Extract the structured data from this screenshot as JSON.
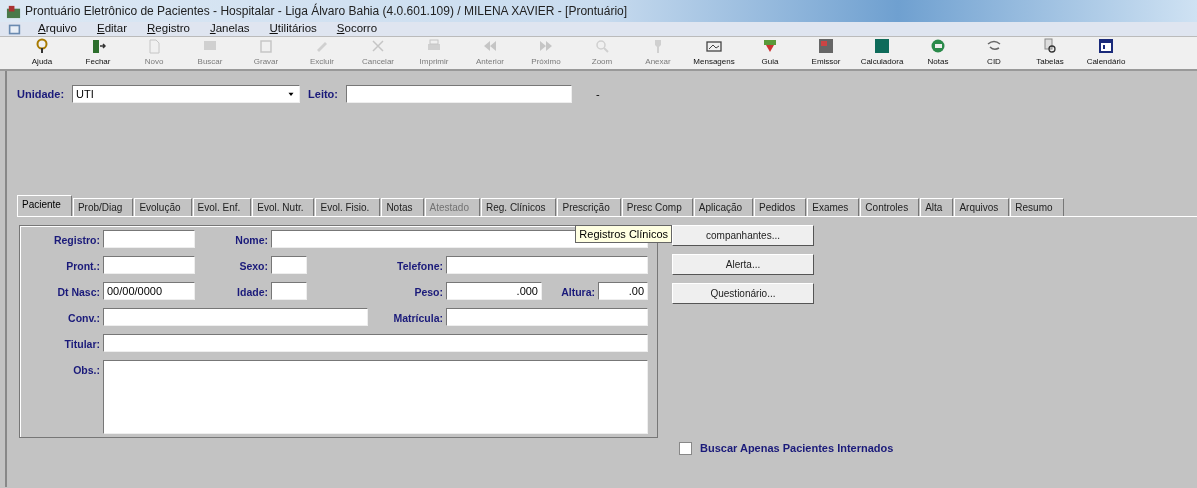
{
  "window": {
    "title": "Prontuário Eletrônico de Pacientes - Hospitalar - Liga Álvaro Bahia (4.0.601.109) / MILENA XAVIER - [Prontuário]"
  },
  "menu": [
    "Arquivo",
    "Editar",
    "Registro",
    "Janelas",
    "Utilitários",
    "Socorro"
  ],
  "toolbar": [
    {
      "label": "Ajuda",
      "disabled": false
    },
    {
      "label": "Fechar",
      "disabled": false
    },
    {
      "label": "Novo",
      "disabled": true
    },
    {
      "label": "Buscar",
      "disabled": true
    },
    {
      "label": "Gravar",
      "disabled": true
    },
    {
      "label": "Excluir",
      "disabled": true
    },
    {
      "label": "Cancelar",
      "disabled": true
    },
    {
      "label": "Imprimir",
      "disabled": true
    },
    {
      "label": "Anterior",
      "disabled": true
    },
    {
      "label": "Próximo",
      "disabled": true
    },
    {
      "label": "Zoom",
      "disabled": true
    },
    {
      "label": "Anexar",
      "disabled": true
    },
    {
      "label": "Mensagens",
      "disabled": false
    },
    {
      "label": "Guia",
      "disabled": false
    },
    {
      "label": "Emissor",
      "disabled": false
    },
    {
      "label": "Calculadora",
      "disabled": false
    },
    {
      "label": "Notas",
      "disabled": false
    },
    {
      "label": "CID",
      "disabled": false
    },
    {
      "label": "Tabelas",
      "disabled": false
    },
    {
      "label": "Calendário",
      "disabled": false
    }
  ],
  "unit": {
    "label": "Unidade:",
    "value": "UTI"
  },
  "bed": {
    "label": "Leito:",
    "suffix": "-"
  },
  "tabs": [
    {
      "label": "Paciente",
      "selected": true,
      "disabled": false
    },
    {
      "label": "Prob/Diag",
      "selected": false,
      "disabled": false
    },
    {
      "label": "Evolução",
      "selected": false,
      "disabled": false
    },
    {
      "label": "Evol. Enf.",
      "selected": false,
      "disabled": false
    },
    {
      "label": "Evol. Nutr.",
      "selected": false,
      "disabled": false
    },
    {
      "label": "Evol. Fisio.",
      "selected": false,
      "disabled": false
    },
    {
      "label": "Notas",
      "selected": false,
      "disabled": false
    },
    {
      "label": "Atestado",
      "selected": false,
      "disabled": true
    },
    {
      "label": "Reg. Clínicos",
      "selected": false,
      "disabled": false
    },
    {
      "label": "Prescrição",
      "selected": false,
      "disabled": false
    },
    {
      "label": "Presc Comp",
      "selected": false,
      "disabled": false
    },
    {
      "label": "Aplicação",
      "selected": false,
      "disabled": false
    },
    {
      "label": "Pedidos",
      "selected": false,
      "disabled": false
    },
    {
      "label": "Exames",
      "selected": false,
      "disabled": false
    },
    {
      "label": "Controles",
      "selected": false,
      "disabled": false
    },
    {
      "label": "Alta",
      "selected": false,
      "disabled": false
    },
    {
      "label": "Arquivos",
      "selected": false,
      "disabled": false
    },
    {
      "label": "Resumo",
      "selected": false,
      "disabled": false
    }
  ],
  "fields": [
    {
      "label": "Registro:"
    },
    {
      "label": "Nome:"
    },
    {
      "label": "Pront.:"
    },
    {
      "label": "Sexo:"
    },
    {
      "label": "Telefone:"
    },
    {
      "label": "Dt Nasc:",
      "value": "00/00/0000"
    },
    {
      "label": "Idade:"
    },
    {
      "label": "Peso:",
      "value": ".000"
    },
    {
      "label": "Altura:",
      "value": ".00"
    },
    {
      "label": "Conv.:"
    },
    {
      "label": "Matrícula:"
    },
    {
      "label": "Titular:"
    },
    {
      "label": "Obs.:"
    }
  ],
  "buttons": [
    "companhantes...",
    "Alerta...",
    "Questionário..."
  ],
  "tooltip": "Registros Clínicos",
  "inpatient_only": {
    "label": "Buscar Apenas Pacientes Internados",
    "checked": false
  }
}
